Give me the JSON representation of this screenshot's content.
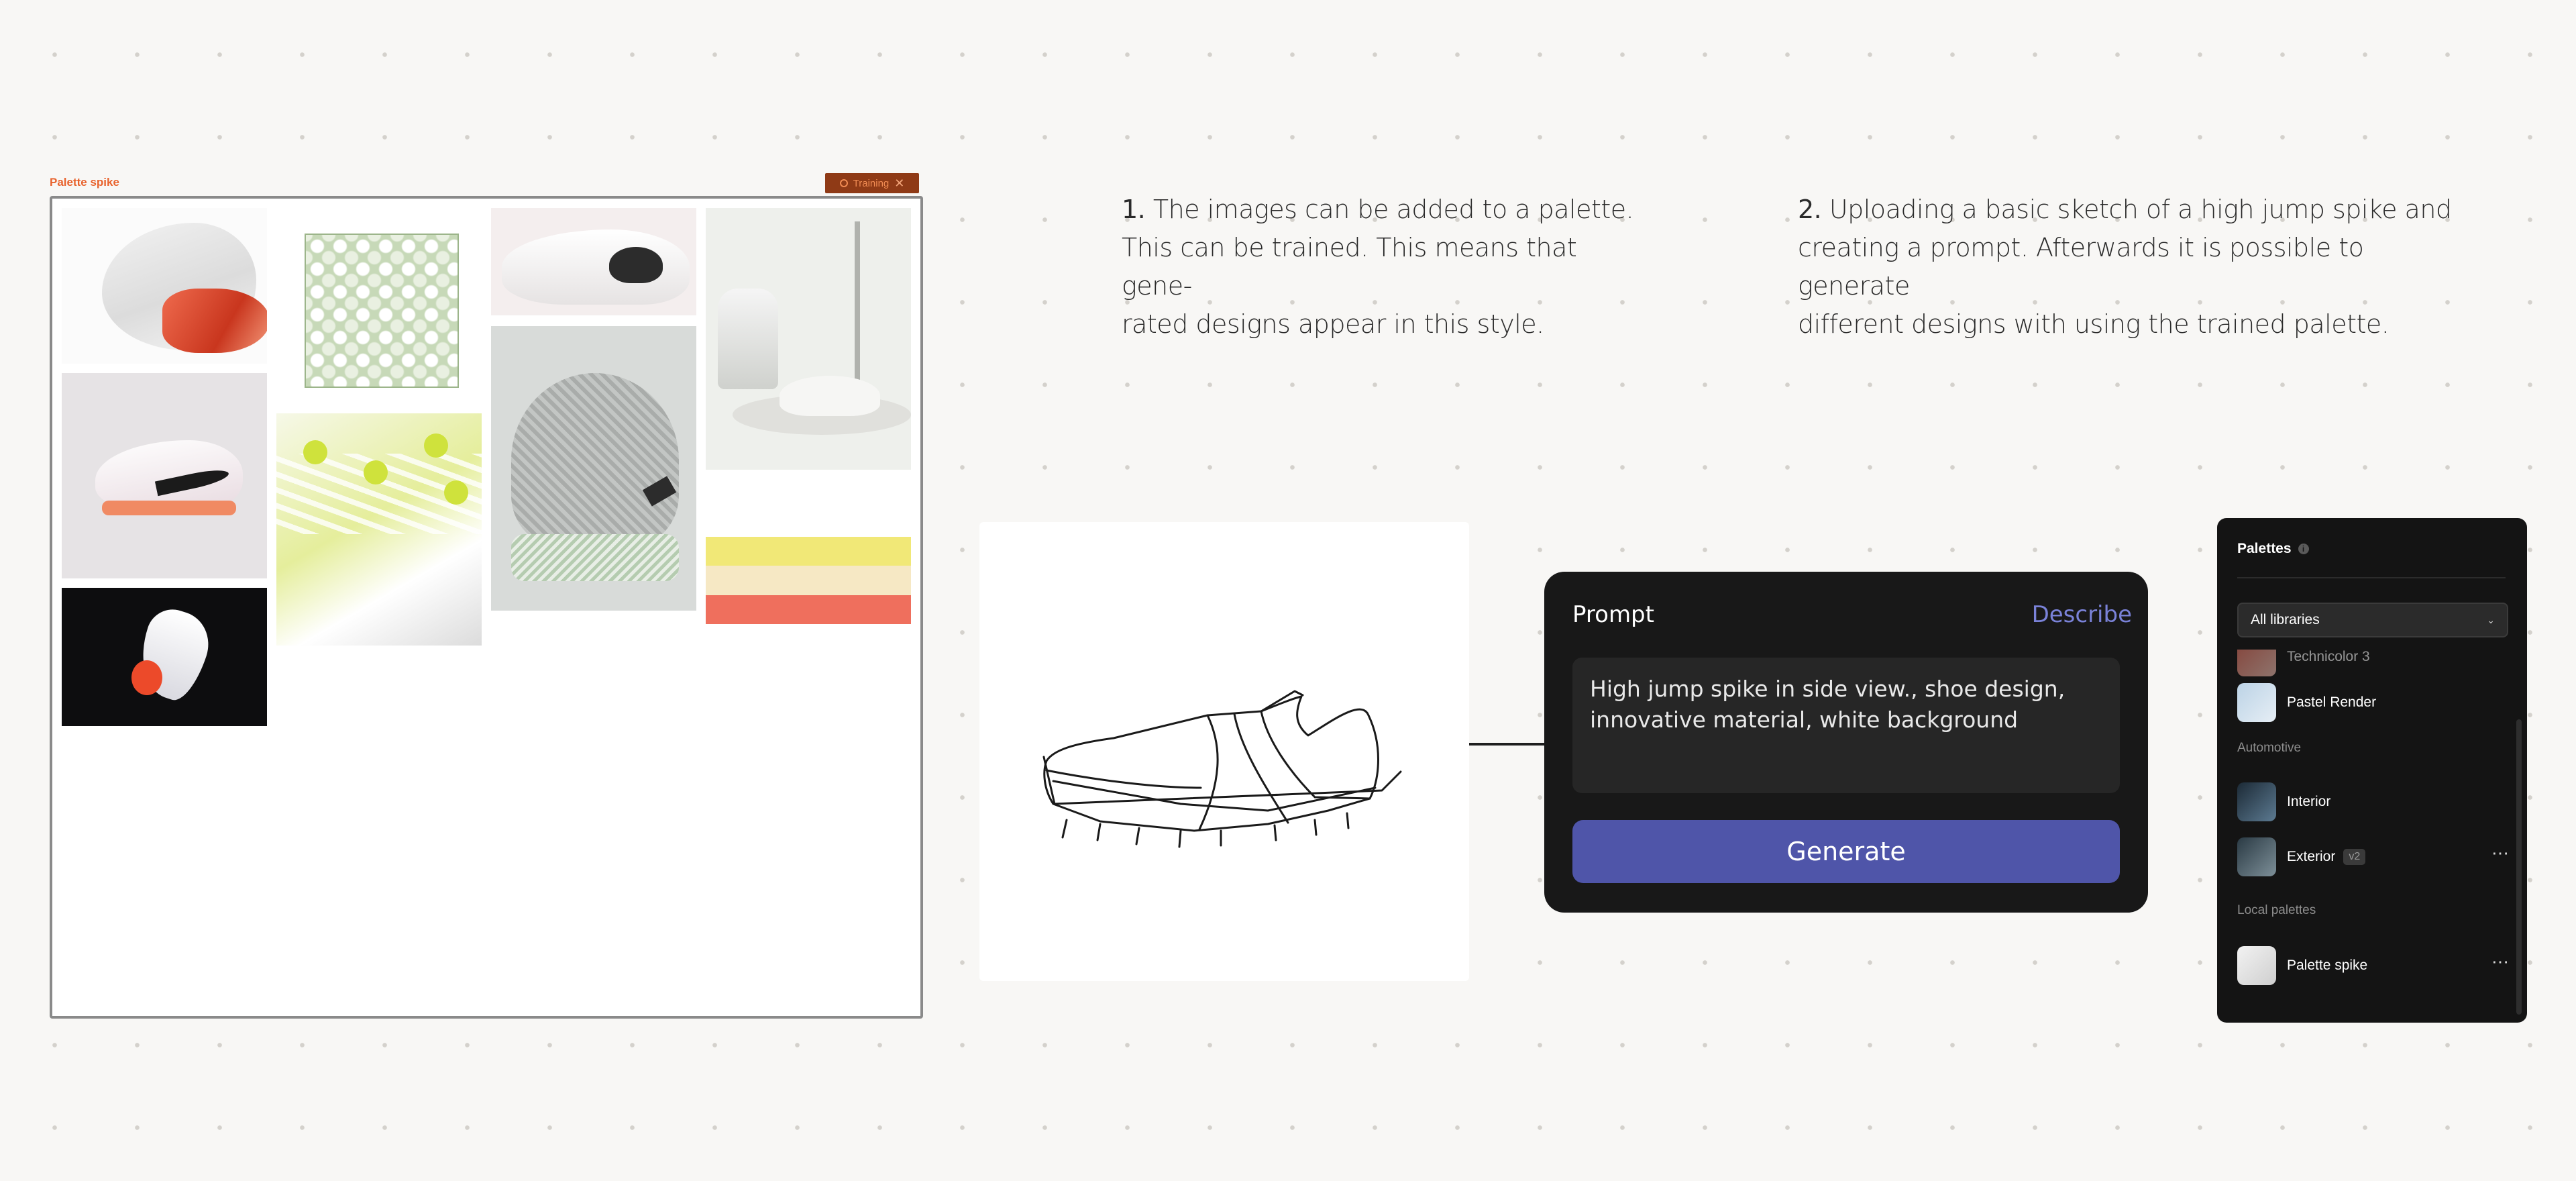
{
  "board": {
    "title": "Palette spike",
    "training_badge": "Training",
    "swatch_colors": [
      "#f1e877",
      "#f6e8c4",
      "#ef6f5d"
    ]
  },
  "descriptions": {
    "step1": {
      "number": "1.",
      "lines": [
        "The images can be added to a palette.",
        "This can be trained. This means that gene-",
        "rated designs appear in this style."
      ]
    },
    "step2": {
      "number": "2.",
      "lines": [
        "Uploading a basic sketch of a high jump spike and",
        "creating a prompt. Afterwards it is possible to generate",
        "different designs with using the trained palette."
      ]
    }
  },
  "prompt": {
    "label": "Prompt",
    "describe_label": "Describe",
    "text_line1": "High jump spike in side view., shoe design,",
    "text_line2": "innovative material, white background",
    "generate_label": "Generate"
  },
  "palettes": {
    "title": "Palettes",
    "info_icon": "i",
    "selector_value": "All libraries",
    "partial_item": "Technicolor 3",
    "items": [
      {
        "label": "Pastel Render"
      },
      {
        "section": "Automotive"
      },
      {
        "label": "Interior"
      },
      {
        "label": "Exterior",
        "version": "v2"
      },
      {
        "section": "Local palettes"
      },
      {
        "label": "Palette spike"
      }
    ],
    "more_icon": "⋯",
    "accent_color": "#4f55a9"
  }
}
